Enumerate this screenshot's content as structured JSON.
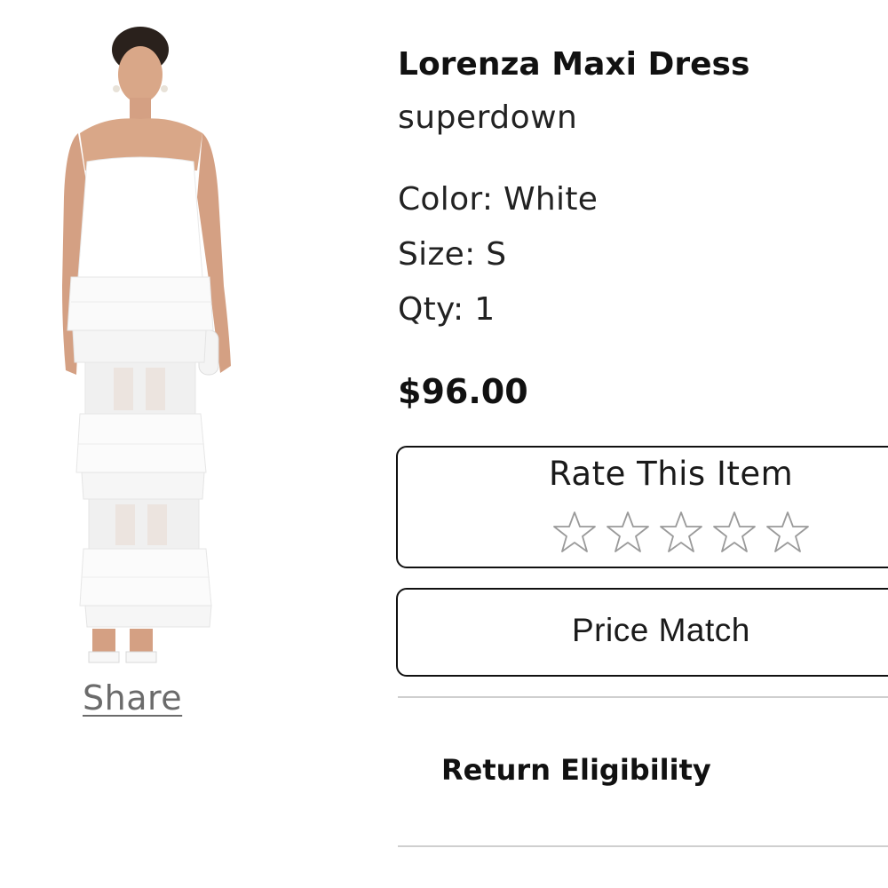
{
  "product": {
    "title": "Lorenza Maxi Dress",
    "brand": "superdown",
    "color": "Color: White",
    "size": "Size: S",
    "qty": "Qty: 1",
    "price": "$96.00"
  },
  "share": {
    "label": "Share"
  },
  "rating": {
    "title": "Rate This Item",
    "stars_total": 5,
    "stars_filled": 0,
    "star_icon": "star-outline-icon"
  },
  "price_match": {
    "label": "Price Match"
  },
  "return_eligibility": {
    "label": "Return Eligibility"
  },
  "colors": {
    "text": "#111111",
    "muted": "#6b6b6b",
    "divider": "#cfcfcf",
    "star_outline": "#9a9a9a"
  }
}
